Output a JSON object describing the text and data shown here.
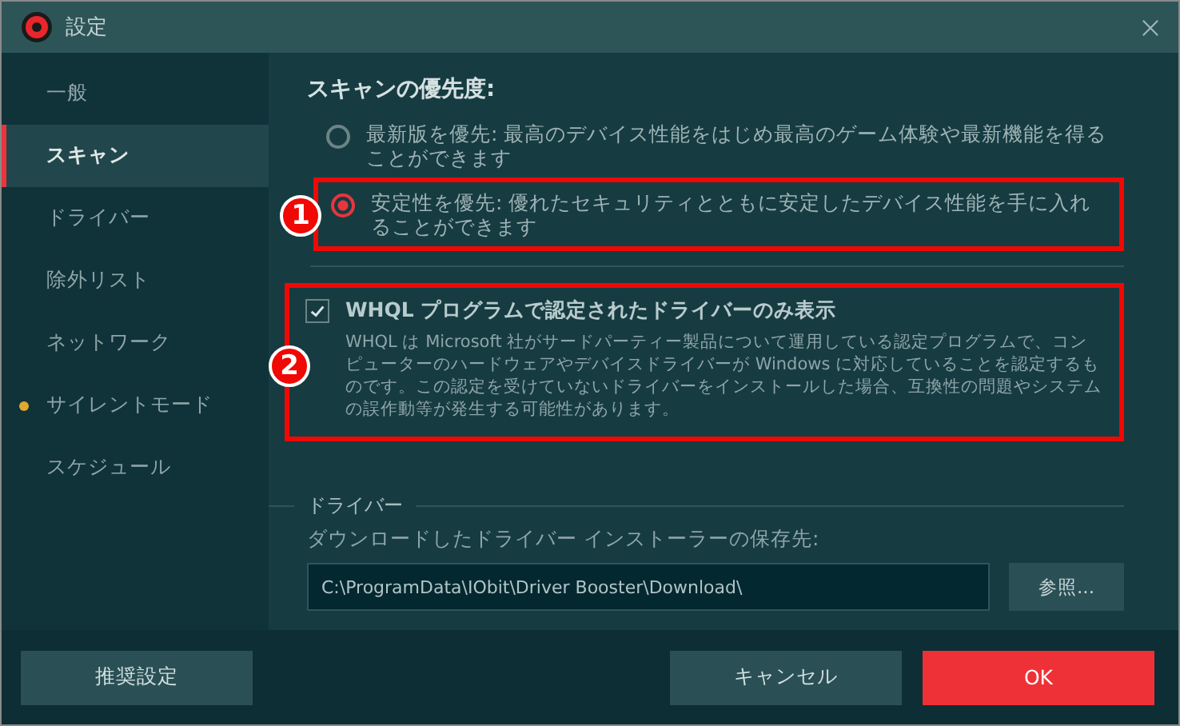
{
  "window": {
    "title": "設定"
  },
  "sidebar": {
    "items": [
      {
        "label": "一般",
        "selected": false,
        "dot": false
      },
      {
        "label": "スキャン",
        "selected": true,
        "dot": false
      },
      {
        "label": "ドライバー",
        "selected": false,
        "dot": false
      },
      {
        "label": "除外リスト",
        "selected": false,
        "dot": false
      },
      {
        "label": "ネットワーク",
        "selected": false,
        "dot": false
      },
      {
        "label": "サイレントモード",
        "selected": false,
        "dot": true
      },
      {
        "label": "スケジュール",
        "selected": false,
        "dot": false
      }
    ]
  },
  "scan_priority": {
    "heading": "スキャンの優先度:",
    "options": [
      {
        "text": "最新版を優先: 最高のデバイス性能をはじめ最高のゲーム体験や最新機能を得ることができます",
        "selected": false
      },
      {
        "text": "安定性を優先: 優れたセキュリティとともに安定したデバイス性能を手に入れることができます",
        "selected": true,
        "annotation": "1"
      }
    ]
  },
  "whql": {
    "label": "WHQL プログラムで認定されたドライバーのみ表示",
    "checked": true,
    "description": "WHQL は Microsoft 社がサードパーティー製品について運用している認定プログラムで、コンピューターのハードウェアやデバイスドライバーが Windows に対応していることを認定するものです。この認定を受けていないドライバーをインストールした場合、互換性の問題やシステムの誤作動等が発生する可能性があります。",
    "annotation": "2"
  },
  "driver": {
    "section": "ドライバー",
    "path_label": "ダウンロードしたドライバー インストーラーの保存先:",
    "path": "C:\\ProgramData\\IObit\\Driver Booster\\Download\\",
    "browse": "参照..."
  },
  "footer": {
    "recommended": "推奨設定",
    "cancel": "キャンセル",
    "ok": "OK"
  }
}
